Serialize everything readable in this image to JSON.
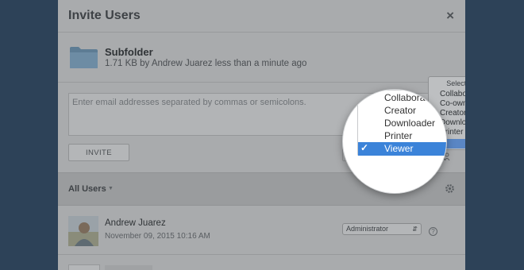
{
  "dialog": {
    "title": "Invite Users",
    "close_symbol": "×"
  },
  "item": {
    "icon": "folder-icon",
    "name": "Subfolder",
    "meta": "1.71 KB by Andrew Juarez less than a minute ago"
  },
  "invite": {
    "placeholder": "Enter email addresses separated by commas or semicolons.",
    "button_label": "INVITE",
    "help_symbol": "?",
    "contacts_icon": "people-icon"
  },
  "role_menu": {
    "header": "Select a Role",
    "items": [
      "Collaborator",
      "Co-owner",
      "Creator",
      "Downloader",
      "Printer",
      "Viewer"
    ],
    "selected": "Viewer",
    "check_symbol": "✓"
  },
  "users_bar": {
    "label": "All Users",
    "caret": "▼",
    "settings_icon": "gear-icon"
  },
  "users": [
    {
      "name": "Andrew Juarez",
      "date": "November 09, 2015 10:16 AM",
      "role": "Administrator",
      "help_symbol": "?"
    }
  ],
  "colors": {
    "background": "#2d4258",
    "overlay": "#a9abad",
    "selection": "#3b83d9"
  }
}
